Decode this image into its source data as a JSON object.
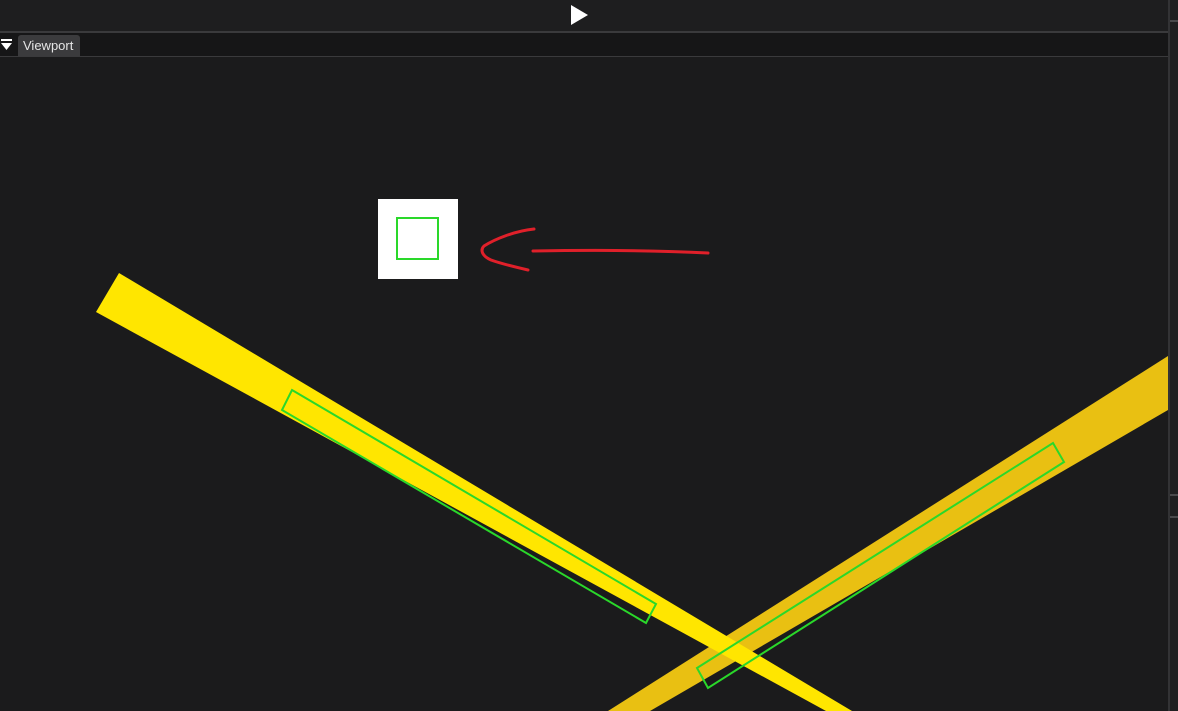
{
  "toolbar": {
    "play_icon": "play-icon"
  },
  "tabs": [
    {
      "label": "Viewport",
      "active": true
    }
  ],
  "tab_menu_icon": "dropdown-menu-icon",
  "viewport": {
    "background_color": "#1b1b1c",
    "objects": [
      {
        "name": "white-square-sprite",
        "color": "#ffffff",
        "selection_color": "#2ad82a"
      },
      {
        "name": "yellow-bar-left",
        "color": "#ffe600",
        "selection_color": "#2ad82a"
      },
      {
        "name": "yellow-bar-right",
        "color": "#e9c012",
        "selection_color": "#2ad82a"
      }
    ],
    "annotation": {
      "name": "red-arrow-annotation",
      "color": "#e0202a"
    }
  }
}
